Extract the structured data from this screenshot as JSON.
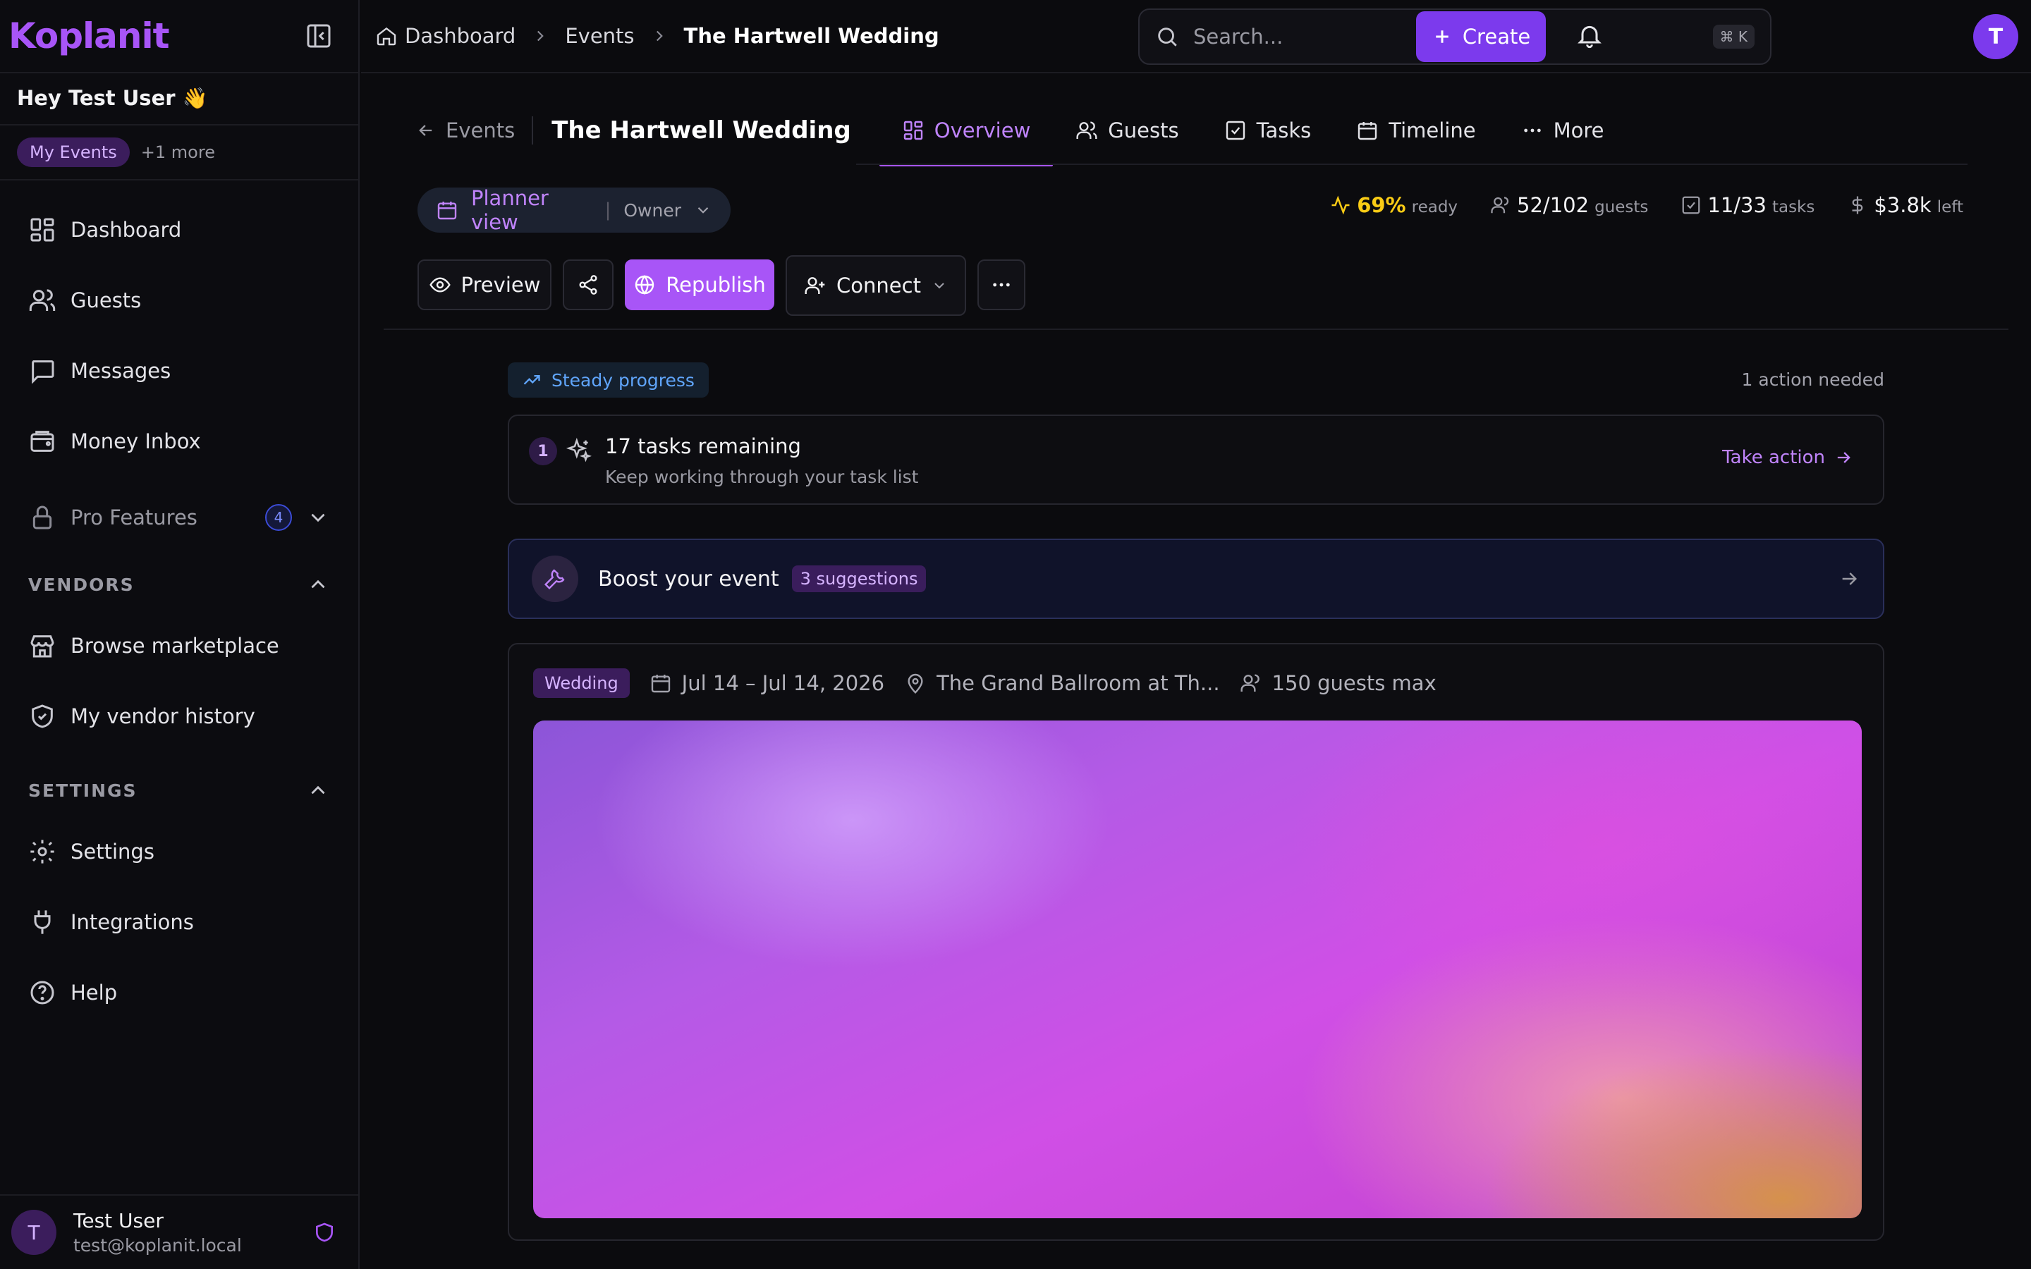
{
  "brand": {
    "logo": "Koplanit",
    "accent": "#a855f7"
  },
  "sidebar": {
    "greeting": "Hey Test User 👋",
    "event_switch": {
      "current": "My Events",
      "more": "+1 more"
    },
    "items": [
      {
        "label": "Dashboard",
        "icon": "dashboard-icon"
      },
      {
        "label": "Guests",
        "icon": "users-icon"
      },
      {
        "label": "Messages",
        "icon": "message-icon"
      },
      {
        "label": "Money Inbox",
        "icon": "wallet-icon"
      }
    ],
    "pro": {
      "label": "Pro Features",
      "count": "4"
    },
    "vendors": {
      "heading": "VENDORS",
      "items": [
        {
          "label": "Browse marketplace",
          "icon": "store-icon"
        },
        {
          "label": "My vendor history",
          "icon": "shield-check-icon"
        }
      ]
    },
    "settings": {
      "heading": "SETTINGS",
      "items": [
        {
          "label": "Settings",
          "icon": "gear-icon"
        },
        {
          "label": "Integrations",
          "icon": "plug-icon"
        },
        {
          "label": "Help",
          "icon": "help-icon"
        }
      ]
    },
    "user": {
      "initial": "T",
      "name": "Test User",
      "email": "test@koplanit.local"
    }
  },
  "topbar": {
    "breadcrumb": [
      "Dashboard",
      "Events",
      "The Hartwell Wedding"
    ],
    "search_placeholder": "Search...",
    "shortcut": "⌘ K",
    "create_label": "Create",
    "avatar_initial": "T"
  },
  "event": {
    "back_label": "Events",
    "title": "The Hartwell Wedding",
    "tabs": [
      {
        "label": "Overview",
        "icon": "grid-icon",
        "active": true
      },
      {
        "label": "Guests",
        "icon": "users-icon"
      },
      {
        "label": "Tasks",
        "icon": "checkbox-icon"
      },
      {
        "label": "Timeline",
        "icon": "calendar-icon"
      },
      {
        "label": "More",
        "icon": "dots-icon"
      }
    ],
    "view": {
      "label": "Planner view",
      "role": "Owner"
    },
    "stats": {
      "ready": {
        "value": "69%",
        "label": "ready"
      },
      "guests": {
        "value": "52/102",
        "label": "guests"
      },
      "tasks": {
        "value": "11/33",
        "label": "tasks"
      },
      "budget": {
        "value": "$3.8k",
        "label": "left"
      }
    },
    "actions": {
      "preview": "Preview",
      "republish": "Republish",
      "connect": "Connect"
    }
  },
  "content": {
    "progress_badge": "Steady progress",
    "action_needed": "1 action needed",
    "task_card": {
      "number": "1",
      "title": "17 tasks remaining",
      "subtitle": "Keep working through your task list",
      "cta": "Take action"
    },
    "boost": {
      "title": "Boost your event",
      "suggestions": "3 suggestions"
    },
    "details": {
      "type": "Wedding",
      "dates": "Jul 14 – Jul 14, 2026",
      "venue": "The Grand Ballroom at Th...",
      "capacity": "150 guests max"
    }
  }
}
